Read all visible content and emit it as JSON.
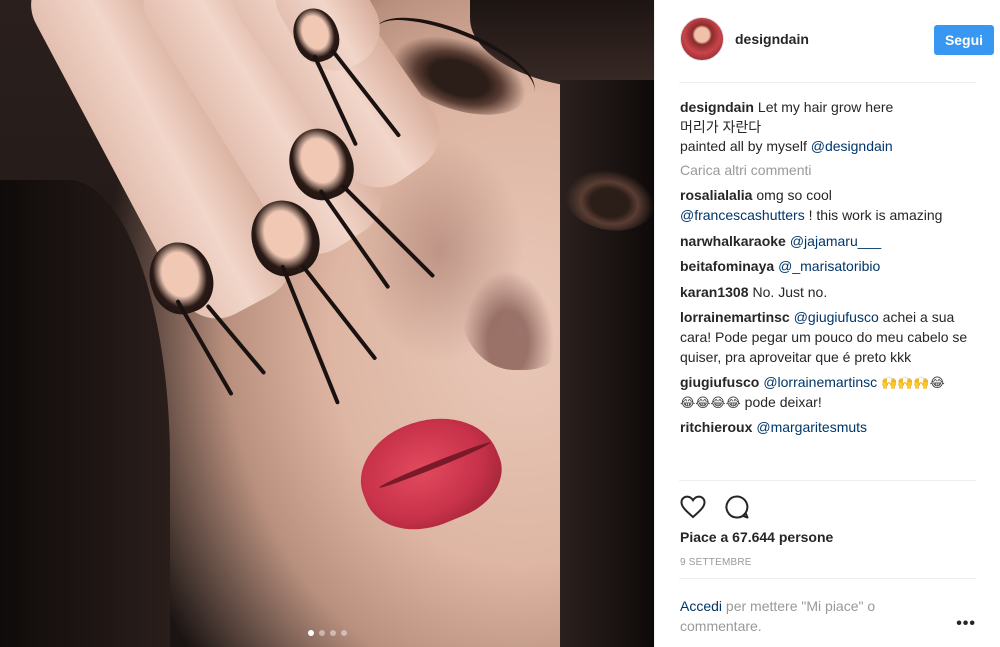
{
  "post": {
    "username": "designdain",
    "follow_label": "Segui",
    "caption_user": "designdain",
    "caption_line1": "Let my hair grow here",
    "caption_line2": "머리가 자란다",
    "caption_line3": "painted all by myself",
    "caption_mention": "@designdain",
    "load_more": "Carica altri commenti",
    "likes": "Piace a 67.644 persone",
    "date": "9 SETTEMBRE",
    "login_link": "Accedi",
    "login_text": " per mettere \"Mi piace\" o commentare.",
    "more_label": "•••"
  },
  "comments": [
    {
      "user": "rosalialalia",
      "text1": "omg so cool",
      "mention": "@francescashutters",
      "text2": " ! this work is amazing"
    },
    {
      "user": "narwhalkaraoke",
      "mention": "@jajamaru___"
    },
    {
      "user": "beitafominaya",
      "mention": "@_marisatoribio"
    },
    {
      "user": "karan1308",
      "text1": "No. Just no."
    },
    {
      "user": "lorrainemartinsc",
      "mention": "@giugiufusco",
      "text2": " achei a sua cara! Pode pegar um pouco do meu cabelo se quiser, pra aproveitar que é preto kkk"
    },
    {
      "user": "giugiufusco",
      "mention": "@lorrainemartinsc",
      "emoji1": "🙌🙌🙌😂",
      "emoji2": "😂😂😂😂",
      "text2": " pode deixar!"
    },
    {
      "user": "ritchieroux",
      "mention": "@margaritesmuts"
    }
  ],
  "carousel": {
    "count": 4,
    "active_index": 0
  },
  "icons": {
    "like": "heart-icon",
    "comment": "comment-bubble-icon",
    "more": "more-options-icon"
  },
  "colors": {
    "follow_button": "#3897f0",
    "link": "#003569",
    "muted": "#999999"
  }
}
